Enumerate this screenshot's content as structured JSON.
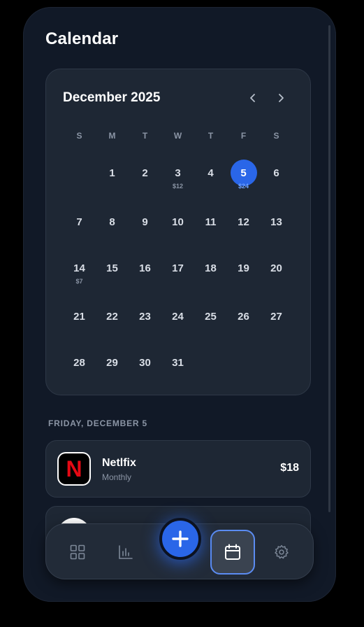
{
  "page": {
    "title": "Calendar"
  },
  "calendar": {
    "month_label": "December 2025",
    "weekdays": [
      "S",
      "M",
      "T",
      "W",
      "T",
      "F",
      "S"
    ],
    "weeks": [
      [
        "",
        "1",
        "2",
        "3",
        "4",
        "5",
        "6"
      ],
      [
        "7",
        "8",
        "9",
        "10",
        "11",
        "12",
        "13"
      ],
      [
        "14",
        "15",
        "16",
        "17",
        "18",
        "19",
        "20"
      ],
      [
        "21",
        "22",
        "23",
        "24",
        "25",
        "26",
        "27"
      ],
      [
        "28",
        "29",
        "30",
        "31",
        "",
        "",
        ""
      ]
    ],
    "selected_day": "5",
    "amounts": {
      "d3": "$12",
      "d5": "$24",
      "d14": "$7"
    },
    "selected_color": "#2a66e8"
  },
  "selected_date_label": "FRIDAY, DECEMBER 5",
  "subscriptions": [
    {
      "name": "Netlfix",
      "cycle": "Monthly",
      "price": "$18",
      "logo_letter": "N",
      "logo_color": "#e50914"
    }
  ],
  "nav": {
    "items": [
      "dashboard",
      "stats",
      "add",
      "calendar",
      "settings"
    ],
    "active": "calendar",
    "accent": "#2a66e8"
  }
}
